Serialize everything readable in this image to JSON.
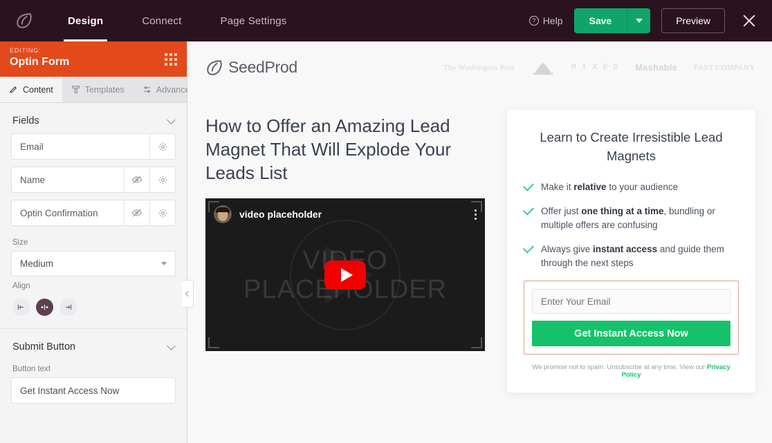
{
  "topbar": {
    "logo_icon": "seedprod-leaf-icon",
    "nav": [
      {
        "label": "Design",
        "active": true
      },
      {
        "label": "Connect",
        "active": false
      },
      {
        "label": "Page Settings",
        "active": false
      }
    ],
    "help_label": "Help",
    "help_icon": "question-circle-icon",
    "save_label": "Save",
    "save_caret_icon": "chevron-down-icon",
    "preview_label": "Preview",
    "close_icon": "close-icon",
    "accent_green": "#0fa56a",
    "background": "#2b121f"
  },
  "sidebar": {
    "editing_label": "EDITING:",
    "editing_title": "Optin Form",
    "drag_handle_icon": "drag-grid-icon",
    "editing_background": "#e24a1b",
    "tabs": [
      {
        "label": "Content",
        "icon": "pencil-icon",
        "active": true
      },
      {
        "label": "Templates",
        "icon": "template-icon",
        "active": false
      },
      {
        "label": "Advanced",
        "icon": "sliders-icon",
        "active": false
      }
    ],
    "fields_section": {
      "title": "Fields",
      "collapse_icon": "chevron-down-icon",
      "rows": [
        {
          "name": "Email",
          "has_visibility_toggle": false,
          "visibility_icon": "eye-off-icon",
          "settings_icon": "gear-icon"
        },
        {
          "name": "Name",
          "has_visibility_toggle": true,
          "visibility_icon": "eye-off-icon",
          "settings_icon": "gear-icon"
        },
        {
          "name": "Optin Confirmation",
          "has_visibility_toggle": true,
          "visibility_icon": "eye-off-icon",
          "settings_icon": "gear-icon"
        }
      ]
    },
    "size_label": "Size",
    "size_value": "Medium",
    "align_label": "Align",
    "align_options": [
      {
        "name": "align-left",
        "icon": "align-left-icon",
        "active": false
      },
      {
        "name": "align-center",
        "icon": "align-center-icon",
        "active": true
      },
      {
        "name": "align-right",
        "icon": "align-right-icon",
        "active": false
      }
    ],
    "submit_section": {
      "title": "Submit Button",
      "collapse_icon": "chevron-down-icon",
      "button_text_label": "Button text",
      "button_text_value": "Get Instant Access Now"
    },
    "collapse_handle_icon": "chevron-left-icon"
  },
  "canvas": {
    "site_logo_text": "SeedProd",
    "site_logo_icon": "seedprod-leaf-icon",
    "press_logos": [
      "The Washington Post",
      "press-badge-icon",
      "M I X E D",
      "Mashable",
      "FAST CØMPANY"
    ],
    "hero_title": "How to Offer an Amazing Lead Magnet That Will Explode Your Leads List",
    "video": {
      "title": "video placeholder",
      "avatar_icon": "channel-avatar-icon",
      "menu_icon": "kebab-menu-icon",
      "watermark_line1": "VIDEO",
      "watermark_line2": "PLACEHOLDER",
      "play_icon": "youtube-play-icon"
    },
    "optin": {
      "title": "Learn to Create Irresistible Lead Magnets",
      "benefits": [
        {
          "prefix": "Make it ",
          "bold": "relative",
          "suffix": " to your audience"
        },
        {
          "prefix": "Offer just ",
          "bold": "one thing at a time",
          "suffix": ", bundling or multiple offers are confusing"
        },
        {
          "prefix": "Always give ",
          "bold": "instant access",
          "suffix": " and guide them through the next steps"
        }
      ],
      "check_icon": "check-icon",
      "email_placeholder": "Enter Your Email",
      "email_value": "",
      "submit_label": "Get Instant Access Now",
      "disclaimer_text": "We promise not to spam. Unsubscrbe at any time. View our ",
      "privacy_link": "Privacy Policy",
      "selection_border_color": "#e0a08a",
      "button_color": "#15c26b"
    }
  }
}
